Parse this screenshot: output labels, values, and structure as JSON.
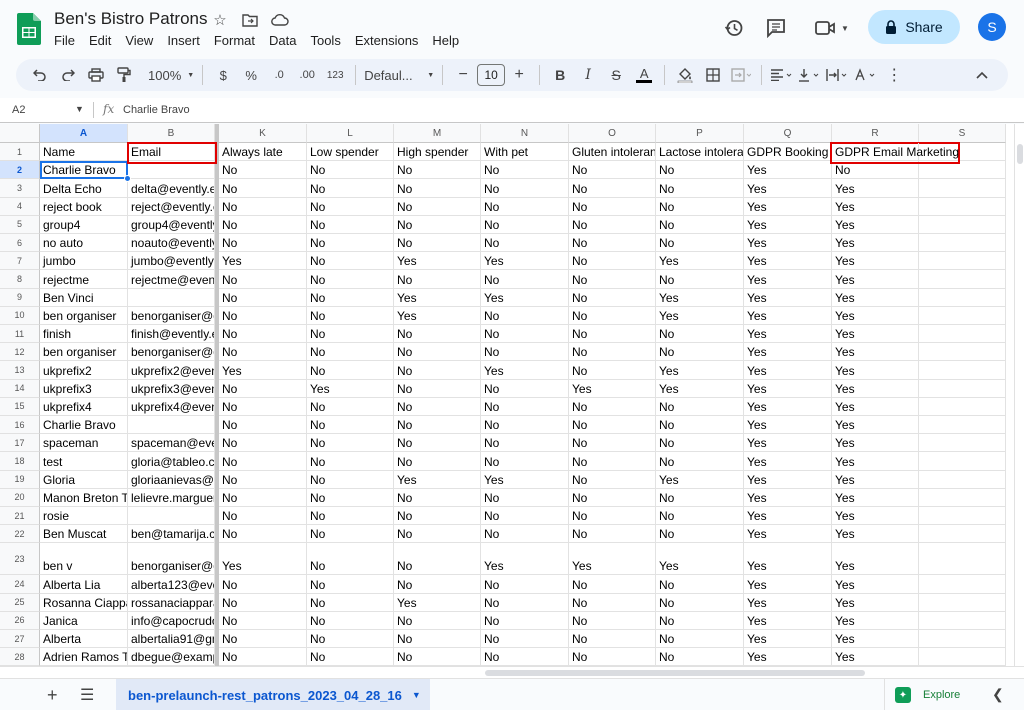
{
  "header": {
    "title": "Ben's Bistro Patrons",
    "menu": [
      "File",
      "Edit",
      "View",
      "Insert",
      "Format",
      "Data",
      "Tools",
      "Extensions",
      "Help"
    ],
    "share_label": "Share",
    "avatar_initial": "S"
  },
  "toolbar": {
    "zoom": "100%",
    "currency": "$",
    "percent": "%",
    "dec_decrease": ".0",
    "dec_increase": ".00",
    "number_format": "123",
    "font": "Defaul...",
    "font_size": "10"
  },
  "formula_bar": {
    "cell_ref": "A2",
    "fx": "fx",
    "value": "Charlie Bravo"
  },
  "grid": {
    "columns": [
      "A",
      "B",
      "K",
      "L",
      "M",
      "N",
      "O",
      "P",
      "Q",
      "R",
      "S"
    ],
    "rows": [
      {
        "n": "1",
        "cells": [
          "Name",
          "Email",
          "Always late",
          "Low spender",
          "High spender",
          "With pet",
          "Gluten intolerant",
          "Lactose intolerant",
          "GDPR Booking",
          "GDPR Email Marketing",
          ""
        ]
      },
      {
        "n": "2",
        "cells": [
          "Charlie Bravo",
          "",
          "No",
          "No",
          "No",
          "No",
          "No",
          "No",
          "Yes",
          "No",
          ""
        ]
      },
      {
        "n": "3",
        "cells": [
          "Delta Echo",
          "delta@evently.eu",
          "No",
          "No",
          "No",
          "No",
          "No",
          "No",
          "Yes",
          "Yes",
          ""
        ]
      },
      {
        "n": "4",
        "cells": [
          "reject book",
          "reject@evently.eu",
          "No",
          "No",
          "No",
          "No",
          "No",
          "No",
          "Yes",
          "Yes",
          ""
        ]
      },
      {
        "n": "5",
        "cells": [
          "group4",
          "group4@evently.eu",
          "No",
          "No",
          "No",
          "No",
          "No",
          "No",
          "Yes",
          "Yes",
          ""
        ]
      },
      {
        "n": "6",
        "cells": [
          "no auto",
          "noauto@evently.eu",
          "No",
          "No",
          "No",
          "No",
          "No",
          "No",
          "Yes",
          "Yes",
          ""
        ]
      },
      {
        "n": "7",
        "cells": [
          "jumbo",
          "jumbo@evently.eu",
          "Yes",
          "No",
          "Yes",
          "Yes",
          "No",
          "Yes",
          "Yes",
          "Yes",
          ""
        ]
      },
      {
        "n": "8",
        "cells": [
          "rejectme",
          "rejectme@evently.eu",
          "No",
          "No",
          "No",
          "No",
          "No",
          "No",
          "Yes",
          "Yes",
          ""
        ]
      },
      {
        "n": "9",
        "cells": [
          "Ben Vinci",
          "",
          "No",
          "No",
          "Yes",
          "Yes",
          "No",
          "Yes",
          "Yes",
          "Yes",
          ""
        ]
      },
      {
        "n": "10",
        "cells": [
          "ben organiser",
          "benorganiser@gmail.com",
          "No",
          "No",
          "Yes",
          "No",
          "No",
          "Yes",
          "Yes",
          "Yes",
          ""
        ]
      },
      {
        "n": "11",
        "cells": [
          "finish",
          "finish@evently.eu",
          "No",
          "No",
          "No",
          "No",
          "No",
          "No",
          "Yes",
          "Yes",
          ""
        ]
      },
      {
        "n": "12",
        "cells": [
          "ben organiser",
          "benorganiser@gmail.com",
          "No",
          "No",
          "No",
          "No",
          "No",
          "No",
          "Yes",
          "Yes",
          ""
        ]
      },
      {
        "n": "13",
        "cells": [
          "ukprefix2",
          "ukprefix2@evently.eu",
          "Yes",
          "No",
          "No",
          "Yes",
          "No",
          "Yes",
          "Yes",
          "Yes",
          ""
        ]
      },
      {
        "n": "14",
        "cells": [
          "ukprefix3",
          "ukprefix3@evently.eu",
          "No",
          "Yes",
          "No",
          "No",
          "Yes",
          "Yes",
          "Yes",
          "Yes",
          ""
        ]
      },
      {
        "n": "15",
        "cells": [
          "ukprefix4",
          "ukprefix4@evently.eu",
          "No",
          "No",
          "No",
          "No",
          "No",
          "No",
          "Yes",
          "Yes",
          ""
        ]
      },
      {
        "n": "16",
        "cells": [
          "Charlie Bravo",
          "",
          "No",
          "No",
          "No",
          "No",
          "No",
          "No",
          "Yes",
          "Yes",
          ""
        ]
      },
      {
        "n": "17",
        "cells": [
          "spaceman",
          "spaceman@evently.eu",
          "No",
          "No",
          "No",
          "No",
          "No",
          "No",
          "Yes",
          "Yes",
          ""
        ]
      },
      {
        "n": "18",
        "cells": [
          "test",
          "gloria@tableo.com",
          "No",
          "No",
          "No",
          "No",
          "No",
          "No",
          "Yes",
          "Yes",
          ""
        ]
      },
      {
        "n": "19",
        "cells": [
          "Gloria",
          "gloriaanievas@gmail.com",
          "No",
          "No",
          "Yes",
          "Yes",
          "No",
          "Yes",
          "Yes",
          "Yes",
          ""
        ]
      },
      {
        "n": "20",
        "cells": [
          "Manon Breton Tellier",
          "lelievre.marguerite@example.org",
          "No",
          "No",
          "No",
          "No",
          "No",
          "No",
          "Yes",
          "Yes",
          ""
        ]
      },
      {
        "n": "21",
        "cells": [
          "rosie",
          "",
          "No",
          "No",
          "No",
          "No",
          "No",
          "No",
          "Yes",
          "Yes",
          ""
        ]
      },
      {
        "n": "22",
        "cells": [
          "Ben Muscat",
          "ben@tamarija.com",
          "No",
          "No",
          "No",
          "No",
          "No",
          "No",
          "Yes",
          "Yes",
          ""
        ]
      },
      {
        "n": "23",
        "cells": [
          "ben v",
          "benorganiser@gmail.com",
          "Yes",
          "No",
          "No",
          "Yes",
          "Yes",
          "Yes",
          "Yes",
          "Yes",
          ""
        ]
      },
      {
        "n": "24",
        "cells": [
          "Alberta Lia",
          "alberta123@evently.eu",
          "No",
          "No",
          "No",
          "No",
          "No",
          "No",
          "Yes",
          "Yes",
          ""
        ]
      },
      {
        "n": "25",
        "cells": [
          "Rosanna Ciappara",
          "rossanaciappara@gmail.com",
          "No",
          "No",
          "Yes",
          "No",
          "No",
          "No",
          "Yes",
          "Yes",
          ""
        ]
      },
      {
        "n": "26",
        "cells": [
          "Janica",
          "info@capocrudo.com",
          "No",
          "No",
          "No",
          "No",
          "No",
          "No",
          "Yes",
          "Yes",
          ""
        ]
      },
      {
        "n": "27",
        "cells": [
          "Alberta",
          "albertalia91@gmail.com",
          "No",
          "No",
          "No",
          "No",
          "No",
          "No",
          "Yes",
          "Yes",
          ""
        ]
      },
      {
        "n": "28",
        "cells": [
          "Adrien Ramos Texier",
          "dbegue@example.org",
          "No",
          "No",
          "No",
          "No",
          "No",
          "No",
          "Yes",
          "Yes",
          ""
        ]
      }
    ]
  },
  "sheet": {
    "tab_label": "ben-prelaunch-rest_patrons_2023_04_28_16",
    "explore_label": "Explore"
  },
  "icons": {
    "logo": "sheets-logo-icon",
    "star": "star-icon",
    "move": "move-to-folder-icon",
    "cloud": "cloud-status-icon",
    "history": "version-history-icon",
    "comment": "comment-icon",
    "meet": "video-call-icon",
    "lock": "lock-icon"
  },
  "colors": {
    "accent": "#1a73e8",
    "share_bg": "#c2e7ff",
    "highlight_box": "#e00000"
  }
}
